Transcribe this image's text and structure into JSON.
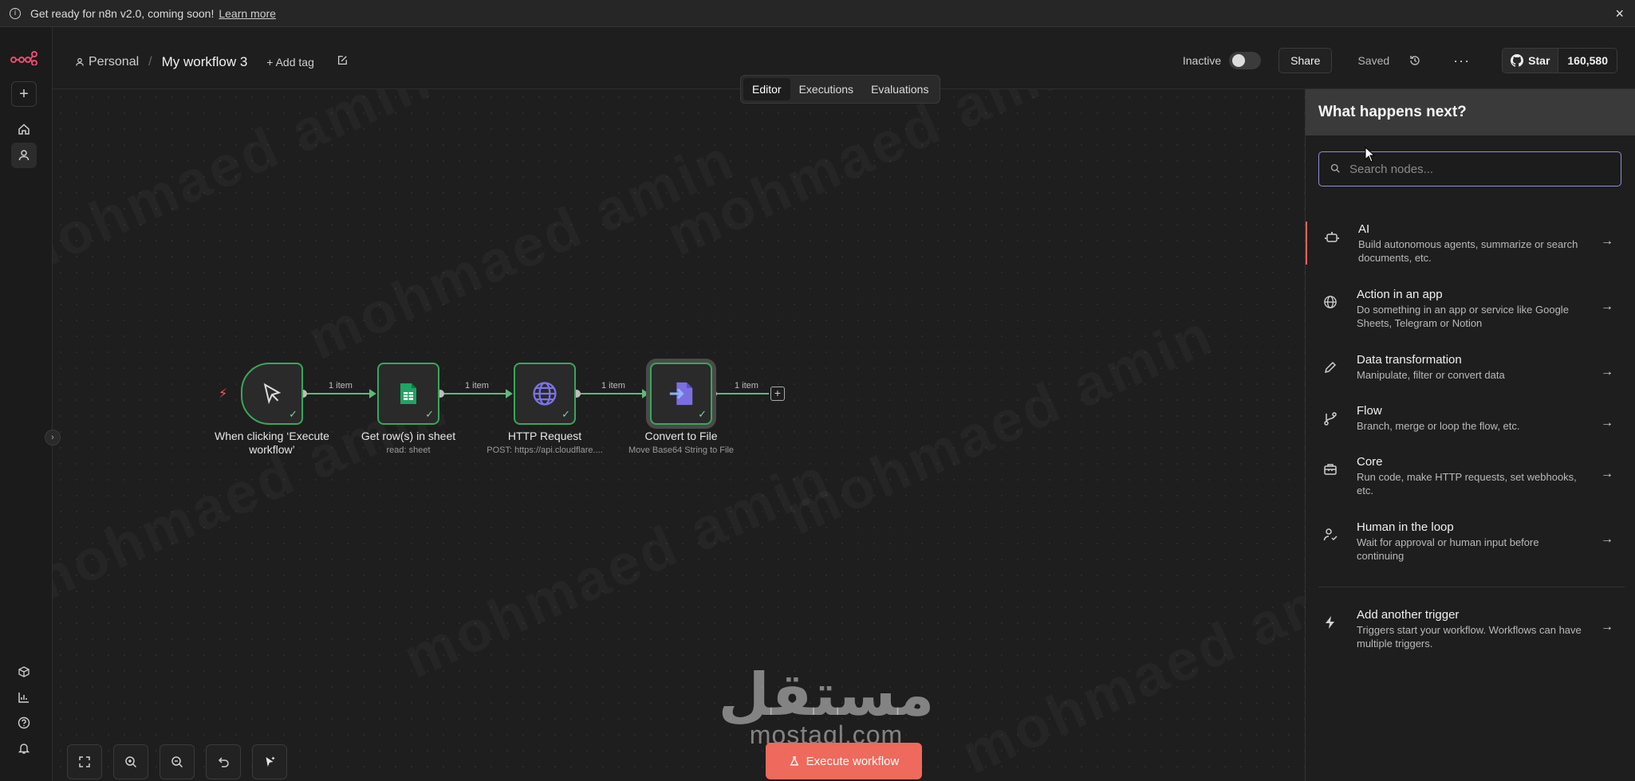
{
  "banner": {
    "text": "Get ready for n8n v2.0, coming soon!",
    "link": "Learn more",
    "close": "×"
  },
  "header": {
    "project": "Personal",
    "separator": "/",
    "workflow_name": "My workflow 3",
    "add_tag": "+ Add tag",
    "status": "Inactive",
    "share": "Share",
    "saved": "Saved",
    "more": "···",
    "github_star": "Star",
    "github_count": "160,580"
  },
  "tabs": [
    "Editor",
    "Executions",
    "Evaluations"
  ],
  "nodes": [
    {
      "label": "When clicking ‘Execute workflow’",
      "sub": "",
      "icon": "cursor-icon"
    },
    {
      "label": "Get row(s) in sheet",
      "sub": "read: sheet",
      "icon": "google-sheets-icon"
    },
    {
      "label": "HTTP Request",
      "sub": "POST: https://api.cloudflare....",
      "icon": "globe-icon"
    },
    {
      "label": "Convert to File",
      "sub": "Move Base64 String to File",
      "icon": "convert-file-icon"
    }
  ],
  "edges": [
    "1 item",
    "1 item",
    "1 item",
    "1 item"
  ],
  "execute_button": "Execute workflow",
  "brand": {
    "arabic": "مستقل",
    "latin": "mostaql.com"
  },
  "watermark": "mohmaed amin",
  "panel": {
    "title": "What happens next?",
    "search_placeholder": "Search nodes...",
    "options": [
      {
        "title": "AI",
        "desc": "Build autonomous agents, summarize or search documents, etc.",
        "icon": "robot-icon"
      },
      {
        "title": "Action in an app",
        "desc": "Do something in an app or service like Google Sheets, Telegram or Notion",
        "icon": "globe-icon"
      },
      {
        "title": "Data transformation",
        "desc": "Manipulate, filter or convert data",
        "icon": "pen-icon"
      },
      {
        "title": "Flow",
        "desc": "Branch, merge or loop the flow, etc.",
        "icon": "branch-icon"
      },
      {
        "title": "Core",
        "desc": "Run code, make HTTP requests, set webhooks, etc.",
        "icon": "toolbox-icon"
      },
      {
        "title": "Human in the loop",
        "desc": "Wait for approval or human input before continuing",
        "icon": "user-check-icon"
      },
      {
        "title": "Add another trigger",
        "desc": "Triggers start your workflow. Workflows can have multiple triggers.",
        "icon": "bolt-icon"
      }
    ]
  },
  "colors": {
    "accent": "#ee6a5c",
    "node_border": "#3aa65a",
    "search_focus": "#8f8fd8"
  }
}
